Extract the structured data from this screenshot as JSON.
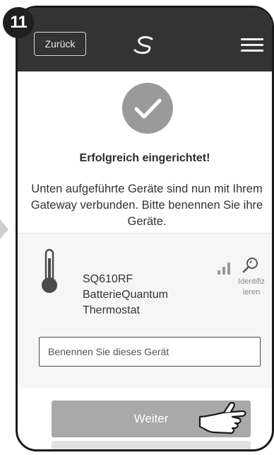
{
  "step": {
    "number": "11"
  },
  "header": {
    "back_label": "Zurück",
    "logo_icon": "s-swirl-logo-icon",
    "menu_icon": "hamburger-menu-icon"
  },
  "status": {
    "check_icon": "checkmark-circle-icon",
    "title": "Erfolgreich eingerichtet!",
    "message": "Unten aufgeführte Geräte sind nun mit Ihrem Gateway verbunden. Bitte benennen Sie ihre Geräte."
  },
  "device": {
    "icon": "thermometer-icon",
    "model": "SQ610RF",
    "name_line1": "BatterieQuantum",
    "name_line2": "Thermostat",
    "signal_icon": "signal-strength-icon",
    "identify_icon": "identify-search-icon",
    "identify_label_line1": "Identifiz",
    "identify_label_line2": "ieren",
    "name_input": {
      "value": "",
      "placeholder": "Benennen Sie dieses Gerät"
    }
  },
  "actions": {
    "weiter_label": "Weiter",
    "hand_icon": "pointing-hand-icon"
  },
  "colors": {
    "header_bg": "#333333",
    "button_bg": "#a9a9a9",
    "check_circle": "#9a9a9a"
  }
}
